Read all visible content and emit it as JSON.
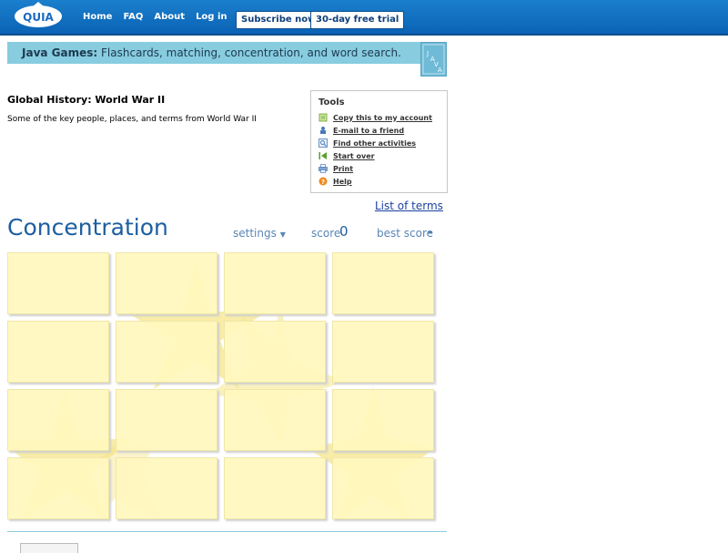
{
  "nav": {
    "logo": "QUIA",
    "links": [
      "Home",
      "FAQ",
      "About",
      "Log in"
    ],
    "subscribe": "Subscribe now",
    "trial": "30-day free trial"
  },
  "banner": {
    "bold": "Java Games:",
    "text": " Flashcards, matching, concentration, and word search.",
    "badge": "JAVA"
  },
  "activity": {
    "title": "Global History: World War II",
    "subtitle": "Some of the key people, places, and terms from World War II"
  },
  "tools": {
    "title": "Tools",
    "items": [
      {
        "label": "Copy this to my account",
        "icon": "copy-icon"
      },
      {
        "label": "E-mail to a friend",
        "icon": "email-icon"
      },
      {
        "label": "Find other activities",
        "icon": "search-icon"
      },
      {
        "label": "Start over",
        "icon": "start-over-icon"
      },
      {
        "label": "Print",
        "icon": "print-icon"
      },
      {
        "label": "Help",
        "icon": "help-icon"
      }
    ]
  },
  "list_of_terms": "List of terms",
  "game": {
    "title": "Concentration",
    "settings": "settings",
    "score_label": "score",
    "score_value": "0",
    "best_label": "best score",
    "best_value": "-"
  },
  "colors": {
    "nav_bg": "#0b63b5",
    "banner_bg": "#88cce0",
    "card_bg": "#fff7be",
    "star": "#f6e58a",
    "title_blue": "#1d5fa0"
  }
}
